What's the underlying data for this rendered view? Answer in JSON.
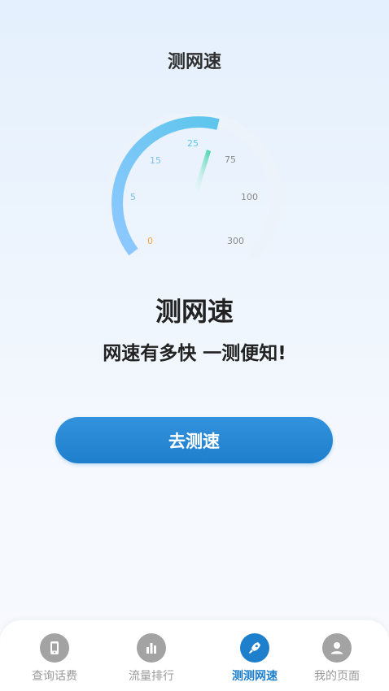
{
  "header": {
    "title": "测网速"
  },
  "gauge": {
    "labels": [
      "0",
      "5",
      "15",
      "25",
      "75",
      "100",
      "300"
    ],
    "accent": "#5cbff0",
    "needle_color": "#3bd0a8",
    "zero_color": "#f4a24a"
  },
  "hero": {
    "title": "测网速",
    "subtitle": "网速有多快 一测便知!"
  },
  "action": {
    "button_label": "去测速"
  },
  "tabbar": {
    "items": [
      {
        "label": "查询话费",
        "icon": "phone-icon"
      },
      {
        "label": "流量排行",
        "icon": "bar-chart-icon"
      },
      {
        "label": "测测网速",
        "icon": "rocket-icon",
        "active": true
      },
      {
        "label": "我的页面",
        "icon": "user-icon"
      }
    ]
  },
  "colors": {
    "primary": "#1e7fcd",
    "inactive_icon": "#9a9a9a"
  }
}
